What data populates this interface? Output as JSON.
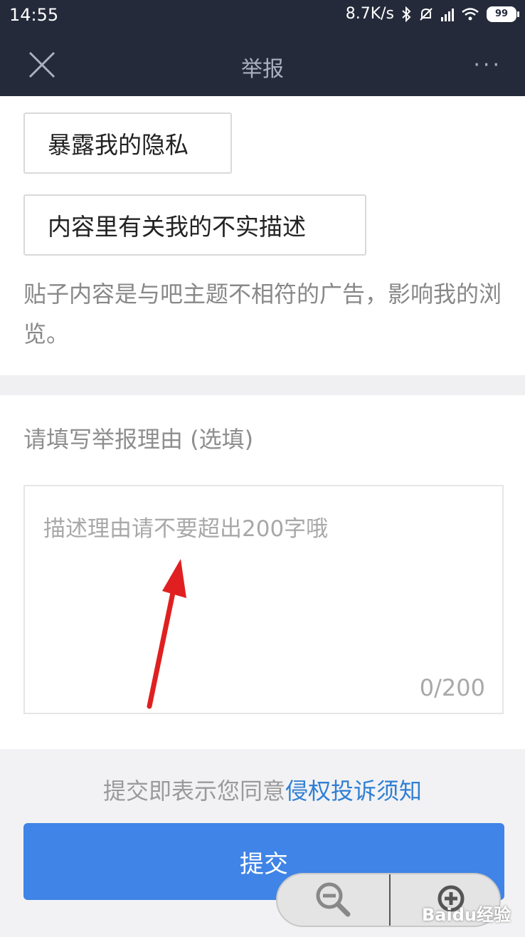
{
  "status_bar": {
    "time": "14:55",
    "net_speed": "8.7K/s",
    "battery": "99"
  },
  "nav": {
    "title": "举报",
    "more": "···"
  },
  "options": [
    {
      "label": "暴露我的隐私"
    },
    {
      "label": "内容里有关我的不实描述"
    }
  ],
  "description": "贴子内容是与吧主题不相符的广告，影响我的浏览。",
  "reason": {
    "label": "请填写举报理由 (选填)",
    "placeholder": "描述理由请不要超出200字哦",
    "counter": "0/200"
  },
  "footer": {
    "agree_prefix": "提交即表示您同意",
    "agree_link": "侵权投诉须知",
    "submit": "提交"
  },
  "watermark": "Baidu经验",
  "colors": {
    "nav_bg": "#242a3a",
    "accent": "#3f84e6",
    "link": "#2f7fd4",
    "arrow": "#e02020"
  },
  "icons": [
    "close-icon",
    "more-icon",
    "bluetooth-icon",
    "mute-icon",
    "signal-icon",
    "wifi-icon",
    "battery-icon",
    "zoom-out-icon",
    "zoom-in-icon"
  ]
}
